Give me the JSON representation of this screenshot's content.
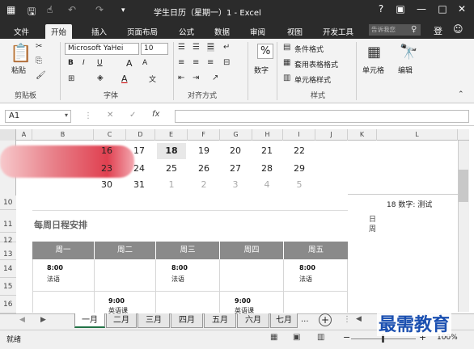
{
  "titlebar": {
    "title": "学生日历（星期一）1 - Excel",
    "help": "?",
    "restore": "▣",
    "minimize": "—",
    "maximize": "□",
    "close": "✕"
  },
  "tabs": [
    "文件",
    "开始",
    "插入",
    "页面布局",
    "公式",
    "数据",
    "审阅",
    "视图",
    "开发工具"
  ],
  "tell_me": "告诉我您",
  "ribbon": {
    "clipboard": {
      "paste": "粘贴",
      "label": "剪贴板"
    },
    "font": {
      "name": "Microsoft YaHei",
      "size": "10",
      "bold": "B",
      "italic": "I",
      "underline": "U",
      "grow": "A",
      "shrink": "A",
      "color": "A",
      "wen": "文",
      "label": "字体"
    },
    "align": {
      "label": "对齐方式"
    },
    "number": {
      "percent": "%",
      "name": "数字"
    },
    "styles": {
      "cond": "条件格式",
      "table": "套用表格格式",
      "cell": "单元格样式",
      "label": "样式"
    },
    "cells": {
      "name": "单元格"
    },
    "editing": {
      "name": "编辑"
    }
  },
  "formula_bar": {
    "name_box": "A1",
    "cancel": "✕",
    "enter": "✓",
    "fx": "fx",
    "value": ""
  },
  "columns": [
    "A",
    "B",
    "C",
    "D",
    "E",
    "F",
    "G",
    "H",
    "I",
    "J",
    "K",
    "L"
  ],
  "rows": [
    "10",
    "11",
    "12",
    "13",
    "14",
    "15",
    "16"
  ],
  "calendar": {
    "row1": [
      "16",
      "17",
      "18",
      "19",
      "20",
      "21",
      "22"
    ],
    "row2": [
      "23",
      "24",
      "25",
      "26",
      "27",
      "28",
      "29"
    ],
    "row3": [
      "30",
      "31",
      "1",
      "2",
      "3",
      "4",
      "5"
    ]
  },
  "side_note": "18 数字: 测试",
  "side_vertical": "日\n周",
  "schedule": {
    "title": "每周日程安排",
    "days": [
      "周一",
      "周二",
      "周三",
      "周四",
      "周五"
    ],
    "events_row1": [
      {
        "time": "8:00",
        "text": "法语"
      },
      {
        "time": "",
        "text": ""
      },
      {
        "time": "8:00",
        "text": "法语"
      },
      {
        "time": "",
        "text": ""
      },
      {
        "time": "8:00",
        "text": "法语"
      }
    ],
    "events_row2": [
      {
        "time": "",
        "text": ""
      },
      {
        "time": "9:00",
        "text": "英语课"
      },
      {
        "time": "",
        "text": ""
      },
      {
        "time": "9:00",
        "text": "英语课"
      },
      {
        "time": "",
        "text": ""
      }
    ]
  },
  "sheets": [
    "一月",
    "二月",
    "三月",
    "四月",
    "五月",
    "六月",
    "七月"
  ],
  "sheet_more": "...",
  "add_sheet": "+",
  "status": {
    "ready": "就绪",
    "zoom": "100%",
    "minus": "−",
    "plus": "+"
  },
  "watermark": "最需教育"
}
